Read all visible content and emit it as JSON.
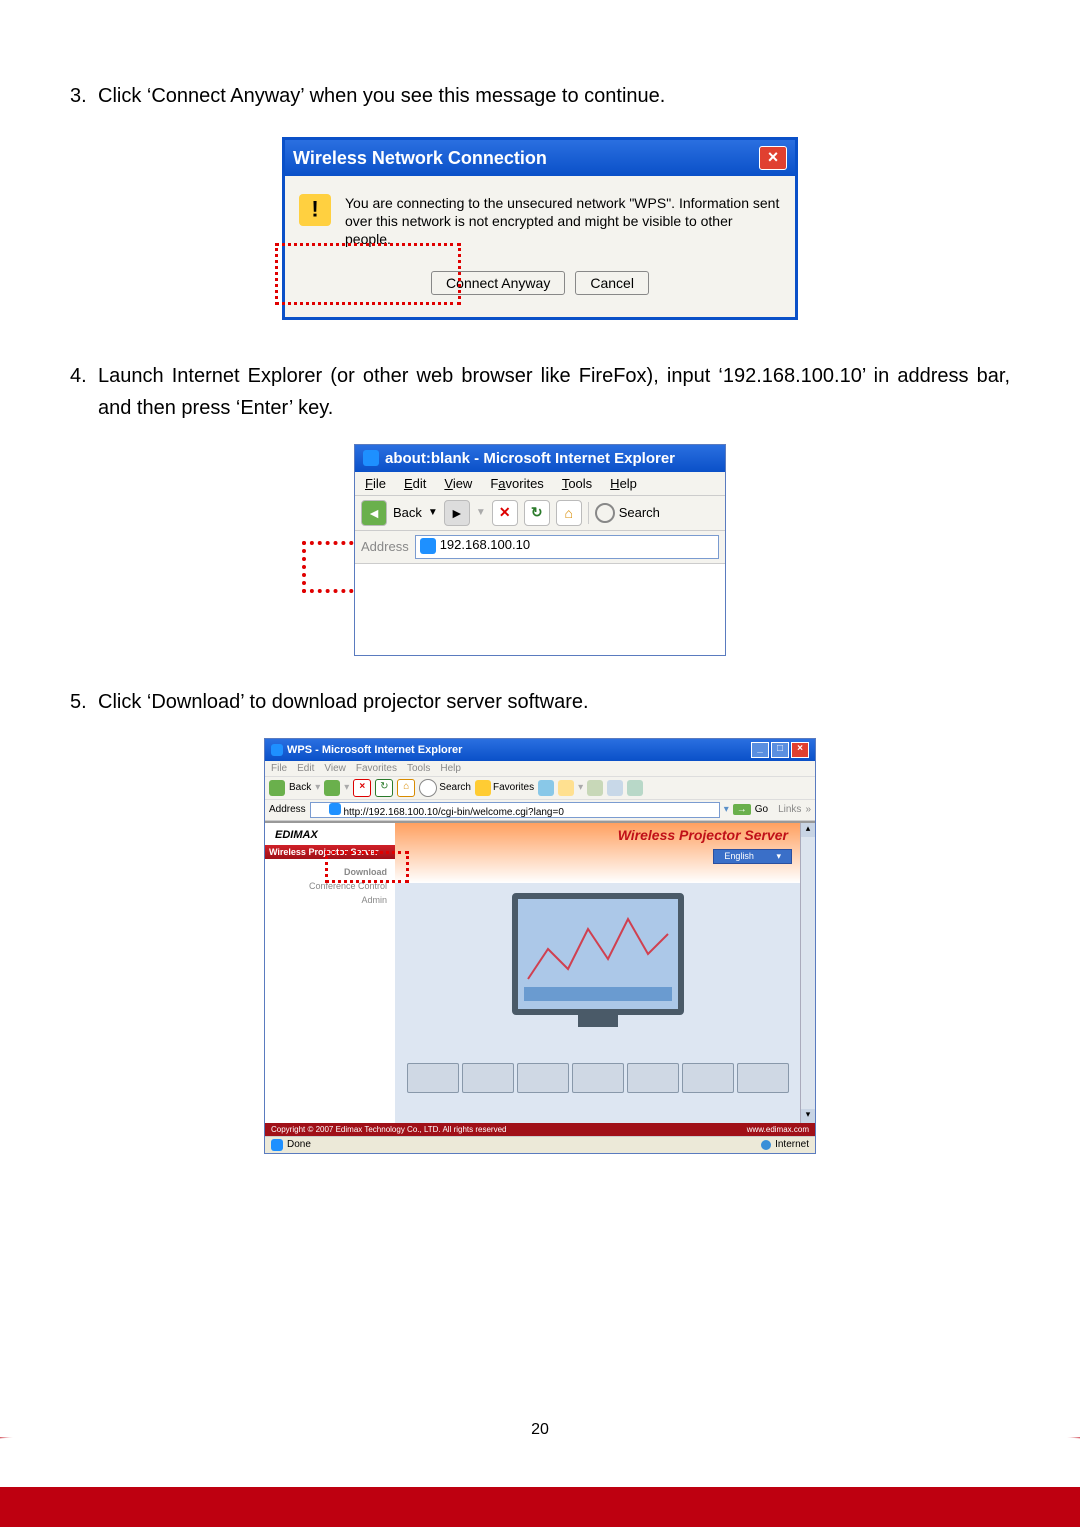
{
  "steps": {
    "s3": {
      "num": "3.",
      "text": "Click ‘Connect Anyway’ when you see this message to continue."
    },
    "s4": {
      "num": "4.",
      "text": "Launch Internet Explorer (or other web browser like FireFox), input ‘192.168.100.10’ in address bar, and then press ‘Enter’ key."
    },
    "s5": {
      "num": "5.",
      "text": "Click ‘Download’ to download projector server software."
    }
  },
  "dialog1": {
    "title": "Wireless Network Connection",
    "message": "You are connecting to the unsecured network \"WPS\". Information sent over this network is not encrypted and might be visible to other people.",
    "btn_connect": "Connect Anyway",
    "btn_cancel": "Cancel"
  },
  "dialog2": {
    "title": "about:blank - Microsoft Internet Explorer",
    "menu": {
      "file": "File",
      "edit": "Edit",
      "view": "View",
      "favorites": "Favorites",
      "tools": "Tools",
      "help": "Help"
    },
    "back": "Back",
    "search": "Search",
    "addr_label": "Address",
    "addr_value": "192.168.100.10"
  },
  "dialog3": {
    "title": "WPS - Microsoft Internet Explorer",
    "menu": {
      "file": "File",
      "edit": "Edit",
      "view": "View",
      "favorites": "Favorites",
      "tools": "Tools",
      "help": "Help"
    },
    "back": "Back",
    "search": "Search",
    "fav": "Favorites",
    "addr_label": "Address",
    "addr_value": "http://192.168.100.10/cgi-bin/welcome.cgi?lang=0",
    "go": "Go",
    "links": "Links",
    "brand": "EDIMAX",
    "page_title": "Wireless Projector Server",
    "side_header": "Wireless Projector Server",
    "side": {
      "download": "Download",
      "conf": "Conference Control",
      "admin": "Admin"
    },
    "lang": "English",
    "copyright": "Copyright © 2007 Edimax Technology Co., LTD. All rights reserved",
    "site": "www.edimax.com",
    "status_done": "Done",
    "status_zone": "Internet"
  },
  "page_number": "20"
}
